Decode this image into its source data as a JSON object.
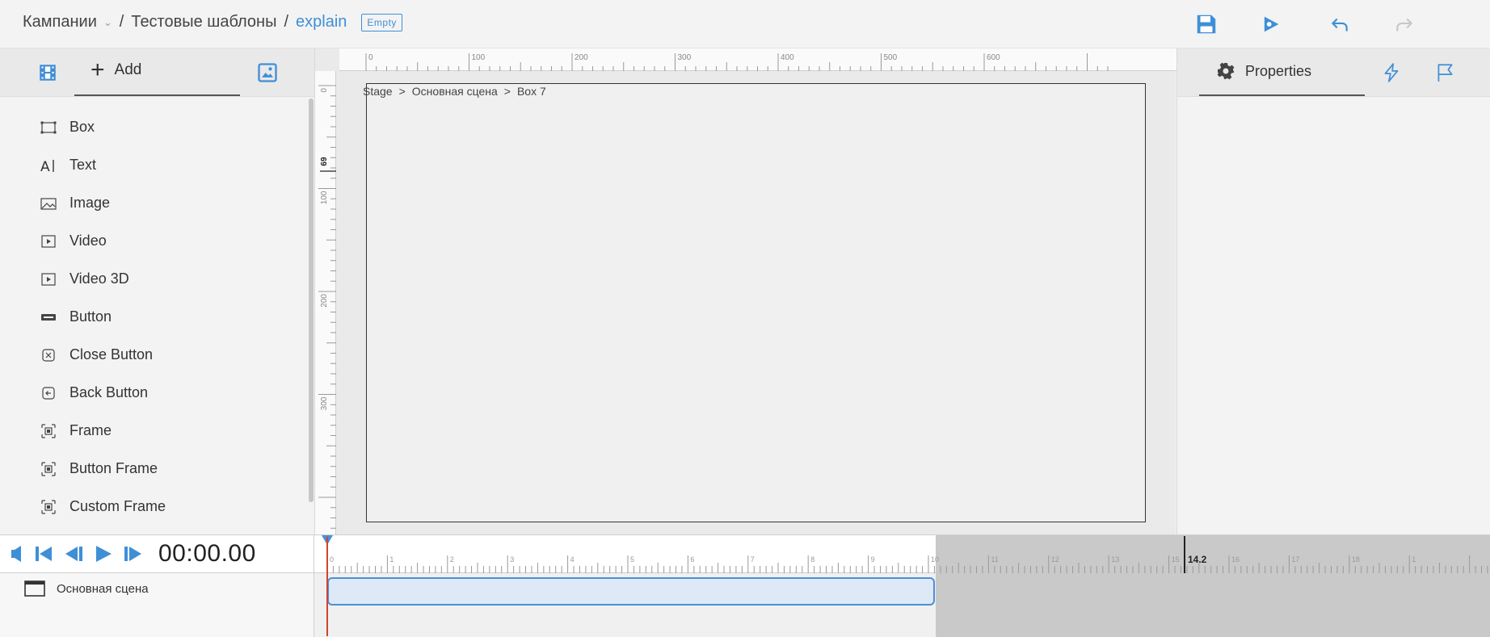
{
  "breadcrumb": {
    "campaigns": "Кампании",
    "campaigns_chevron": "⌄",
    "sep1": "/",
    "templates": "Тестовые шаблоны",
    "sep2": "/",
    "current": "explain",
    "status_badge": "Empty"
  },
  "toolbar": {
    "save_icon": "save-icon",
    "preview_icon": "preview-icon",
    "undo_icon": "undo-icon",
    "redo_icon": "redo-icon",
    "accent_color": "#3f8fd6"
  },
  "left_panel": {
    "add_label": "Add",
    "elements": [
      {
        "label": "Box",
        "icon": "box-icon"
      },
      {
        "label": "Text",
        "icon": "text-icon"
      },
      {
        "label": "Image",
        "icon": "image-icon"
      },
      {
        "label": "Video",
        "icon": "video-icon"
      },
      {
        "label": "Video 3D",
        "icon": "video-icon"
      },
      {
        "label": "Button",
        "icon": "button-icon"
      },
      {
        "label": "Close Button",
        "icon": "close-button-icon"
      },
      {
        "label": "Back Button",
        "icon": "back-button-icon"
      },
      {
        "label": "Frame",
        "icon": "frame-icon"
      },
      {
        "label": "Button Frame",
        "icon": "frame-icon"
      },
      {
        "label": "Custom Frame",
        "icon": "frame-icon"
      }
    ]
  },
  "canvas": {
    "path": [
      "Stage",
      ">",
      "Основная сцена",
      ">",
      "Box 7"
    ],
    "ruler_h_labels": [
      "0",
      "100",
      "200",
      "300",
      "400",
      "500",
      "600"
    ],
    "ruler_v_labels": [
      "0",
      "100",
      "200",
      "300"
    ],
    "ruler_v_marker": "69"
  },
  "right_panel": {
    "properties_label": "Properties",
    "events_icon": "lightning-icon",
    "flag_icon": "flag-icon"
  },
  "timeline": {
    "time": "00:00.00",
    "layer_name": "Основная сцена",
    "ruler_labels": [
      "0",
      "1",
      "2",
      "3",
      "4",
      "5",
      "6",
      "7",
      "8",
      "9",
      "10",
      "11",
      "12",
      "13",
      "14.2",
      "15",
      "16",
      "17",
      "18",
      "1"
    ],
    "end_marker": "14.2"
  }
}
